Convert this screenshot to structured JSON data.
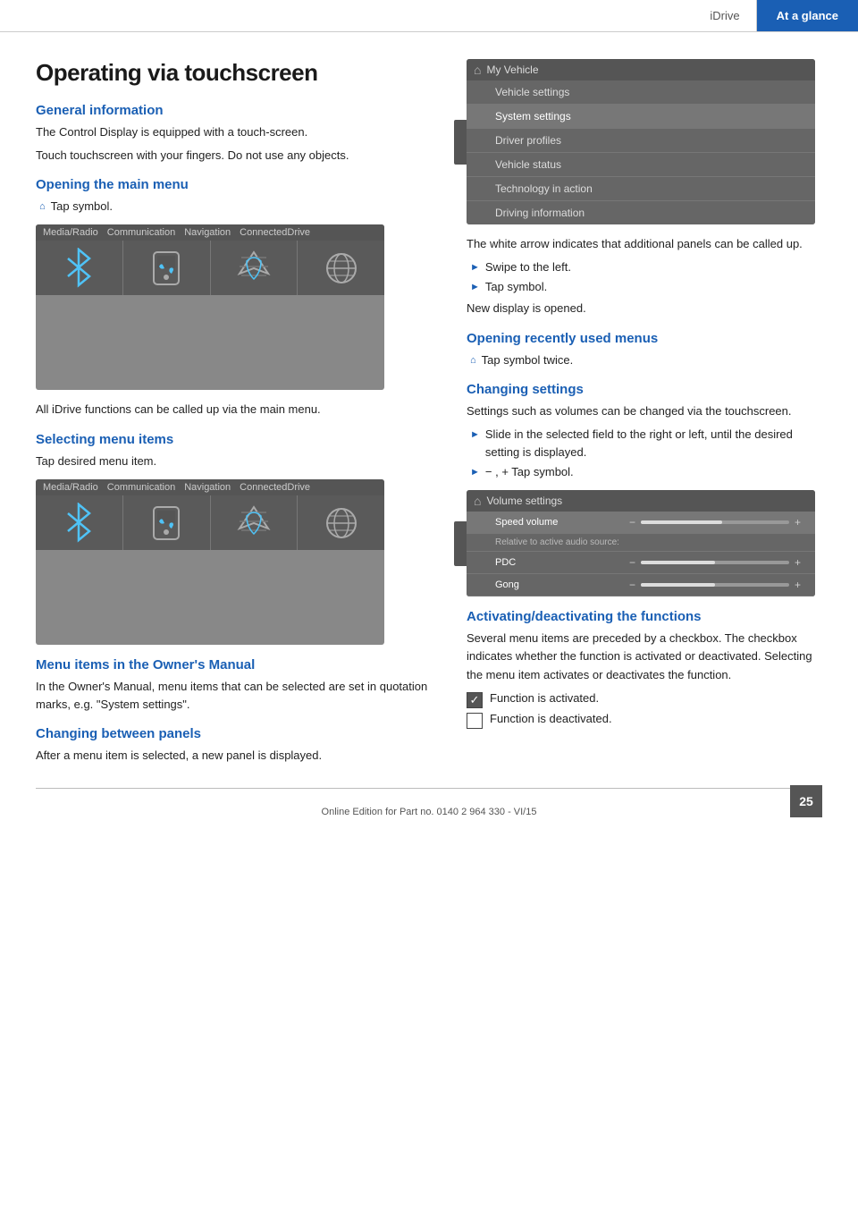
{
  "header": {
    "idrive_label": "iDrive",
    "at_a_glance_label": "At a glance"
  },
  "page": {
    "title": "Operating via touchscreen"
  },
  "left_col": {
    "sections": [
      {
        "id": "general_info",
        "heading": "General information",
        "paragraphs": [
          "The Control Display is equipped with a touch-screen.",
          "Touch touchscreen with your fingers. Do not use any objects."
        ]
      },
      {
        "id": "opening_main_menu",
        "heading": "Opening the main menu",
        "tap_symbol_text": "Tap symbol.",
        "below_image_text": "All iDrive functions can be called up via the main menu."
      },
      {
        "id": "selecting_menu_items",
        "heading": "Selecting menu items",
        "paragraphs": [
          "Tap desired menu item."
        ]
      },
      {
        "id": "menu_items_manual",
        "heading": "Menu items in the Owner's Manual",
        "paragraphs": [
          "In the Owner's Manual, menu items that can be selected are set in quotation marks, e.g. \"System settings\"."
        ]
      },
      {
        "id": "changing_panels",
        "heading": "Changing between panels",
        "paragraphs": [
          "After a menu item is selected, a new panel is displayed."
        ]
      }
    ]
  },
  "right_col": {
    "sections": [
      {
        "id": "car_menu_intro",
        "paragraphs": [
          "The white arrow indicates that additional panels can be called up."
        ],
        "bullets": [
          "Swipe to the left.",
          "Tap symbol."
        ],
        "after_text": "New display is opened."
      },
      {
        "id": "opening_recently",
        "heading": "Opening recently used menus",
        "tap_twice_text": "Tap symbol twice."
      },
      {
        "id": "changing_settings",
        "heading": "Changing settings",
        "paragraphs": [
          "Settings such as volumes can be changed via the touchscreen."
        ],
        "bullets": [
          "Slide in the selected field to the right or left, until the desired setting is displayed.",
          "−  ,  +  Tap symbol."
        ]
      },
      {
        "id": "activating_deactivating",
        "heading": "Activating/deactivating the functions",
        "paragraphs": [
          "Several menu items are preceded by a checkbox. The checkbox indicates whether the function is activated or deactivated. Selecting the menu item activates or deactivates the function."
        ],
        "checkbox_items": [
          {
            "checked": true,
            "text": "Function is activated."
          },
          {
            "checked": false,
            "text": "Function is deactivated."
          }
        ]
      }
    ]
  },
  "screen_mockup_1": {
    "tabs": [
      "Media/Radio",
      "Communication",
      "Navigation",
      "ConnectedDrive"
    ],
    "icon_labels": [
      "bluetooth",
      "phone",
      "nav",
      "globe"
    ]
  },
  "screen_mockup_2": {
    "tabs": [
      "Media/Radio",
      "Communication",
      "Navigation",
      "ConnectedDrive"
    ],
    "icon_labels": [
      "bluetooth",
      "phone",
      "nav",
      "globe"
    ]
  },
  "car_display": {
    "home_icon": "⌂",
    "menu_title": "My Vehicle",
    "items": [
      {
        "label": "Vehicle settings",
        "active": false
      },
      {
        "label": "System settings",
        "active": true
      },
      {
        "label": "Driver profiles",
        "active": false
      },
      {
        "label": "Vehicle status",
        "active": false
      },
      {
        "label": "Technology in action",
        "active": false
      },
      {
        "label": "Driving information",
        "active": false
      }
    ]
  },
  "volume_display": {
    "home_icon": "⌂",
    "title": "Volume settings",
    "settings": [
      {
        "label": "Speed volume",
        "fill_pct": 55,
        "highlighted": true
      },
      {
        "sublabel": "Relative to active audio source:"
      },
      {
        "label": "PDC",
        "fill_pct": 50,
        "highlighted": false
      },
      {
        "label": "Gong",
        "fill_pct": 50,
        "highlighted": false
      }
    ]
  },
  "footer": {
    "text": "Online Edition for Part no. 0140 2 964 330 - VI/15",
    "page_number": "25"
  }
}
